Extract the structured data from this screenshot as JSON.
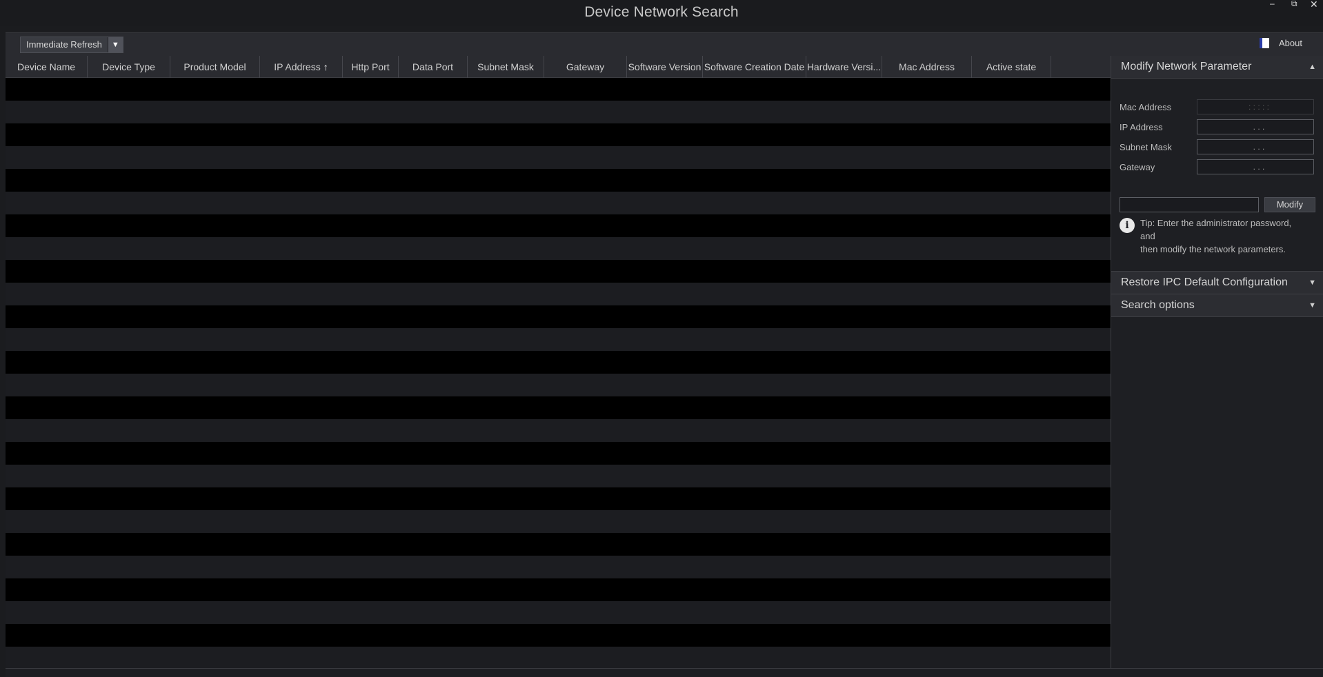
{
  "window": {
    "title": "Device Network Search",
    "controls": {
      "minimize": "–",
      "restore": "⧉",
      "close": "✕"
    }
  },
  "toolbar": {
    "refresh_label": "Immediate Refresh",
    "dropdown_icon": "▼",
    "about_label": "About"
  },
  "table": {
    "columns": [
      {
        "label": "Device Name"
      },
      {
        "label": "Device Type"
      },
      {
        "label": "Product Model"
      },
      {
        "label": "IP Address",
        "sorted": "asc"
      },
      {
        "label": "Http Port"
      },
      {
        "label": "Data Port"
      },
      {
        "label": "Subnet Mask"
      },
      {
        "label": "Gateway"
      },
      {
        "label": "Software Version"
      },
      {
        "label": "Software Creation Date"
      },
      {
        "label": "Hardware Versi..."
      },
      {
        "label": "Mac Address"
      },
      {
        "label": "Active state"
      }
    ],
    "rows": [],
    "sort_icon": "🡅"
  },
  "sidebar": {
    "modify": {
      "header": "Modify Network Parameter",
      "arrow": "▲",
      "fields": [
        {
          "label": "Mac Address",
          "value": ":   :   :   :   :"
        },
        {
          "label": "IP Address",
          "value": ".   .   ."
        },
        {
          "label": "Subnet Mask",
          "value": ".   .   ."
        },
        {
          "label": "Gateway",
          "value": ".   .   ."
        }
      ],
      "password_value": "",
      "modify_button": "Modify",
      "tip_line1": "Tip: Enter the administrator password, and",
      "tip_line2": "then modify the network parameters."
    },
    "restore": {
      "header": "Restore IPC Default Configuration",
      "arrow": "▼"
    },
    "search": {
      "header": "Search options",
      "arrow": "▼"
    }
  },
  "colors": {
    "background": "#1b1c1f",
    "row_alt": "#1c1d21",
    "header": "#2a2b30",
    "text": "#c9c9c9"
  }
}
